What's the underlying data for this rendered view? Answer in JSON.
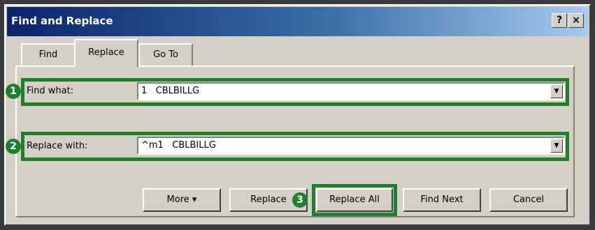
{
  "dialog": {
    "title": "Find and Replace",
    "help_button": "?",
    "close_button": "×"
  },
  "tabs": [
    {
      "label": "Find"
    },
    {
      "label": "Replace"
    },
    {
      "label": "Go To"
    }
  ],
  "find": {
    "label": "Find what:",
    "value": "1   CBLBILLG"
  },
  "replace": {
    "label": "Replace with:",
    "value": "^m1   CBLBILLG"
  },
  "buttons": {
    "more": "More  ▾",
    "replace": "Replace",
    "replace_all": "Replace All",
    "find_next": "Find Next",
    "cancel": "Cancel"
  },
  "annotations": [
    "1",
    "2",
    "3"
  ],
  "colors": {
    "highlight": "#1f7f2a",
    "titlebar": "#0a246a"
  }
}
